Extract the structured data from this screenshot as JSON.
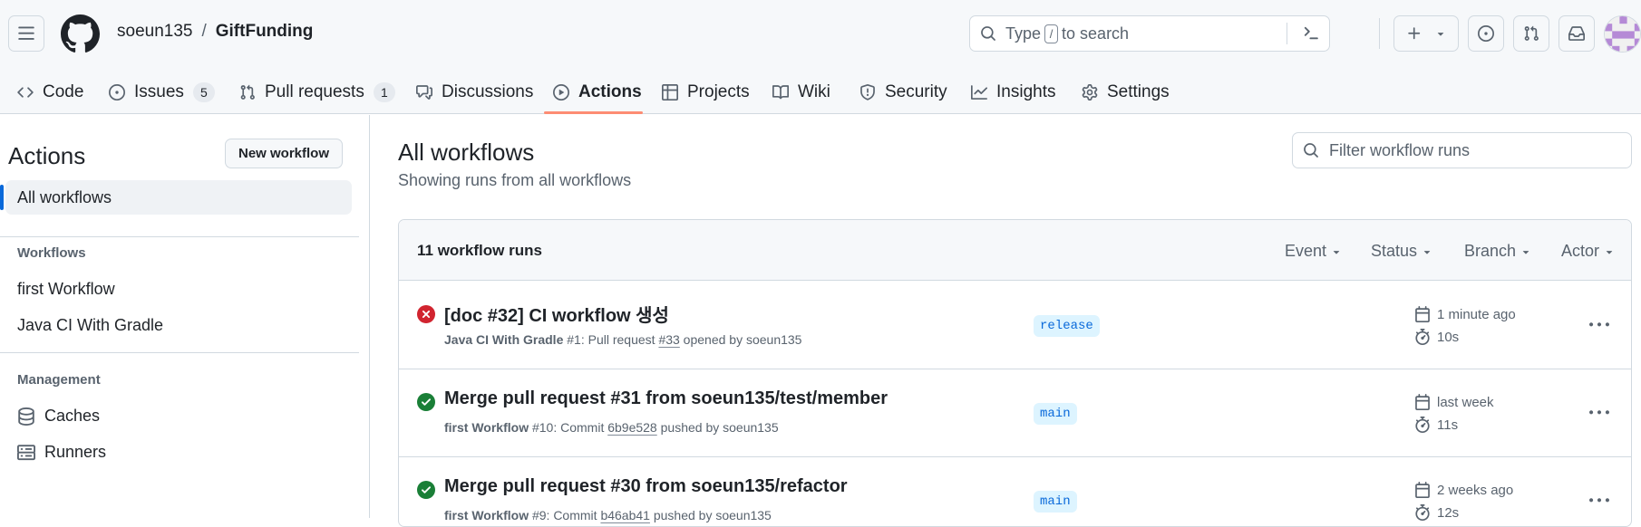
{
  "repo": {
    "owner": "soeun135",
    "separator": "/",
    "name": "GiftFunding"
  },
  "search": {
    "prefix": "Type",
    "key": "/",
    "suffix": "to search"
  },
  "nav": {
    "tabs": [
      {
        "label": "Code",
        "icon": "code-icon"
      },
      {
        "label": "Issues",
        "icon": "issue-opened-icon",
        "count": "5"
      },
      {
        "label": "Pull requests",
        "icon": "git-pull-request-icon",
        "count": "1"
      },
      {
        "label": "Discussions",
        "icon": "comment-discussion-icon"
      },
      {
        "label": "Actions",
        "icon": "play-icon",
        "active": true
      },
      {
        "label": "Projects",
        "icon": "table-icon"
      },
      {
        "label": "Wiki",
        "icon": "book-icon"
      },
      {
        "label": "Security",
        "icon": "shield-icon"
      },
      {
        "label": "Insights",
        "icon": "graph-icon"
      },
      {
        "label": "Settings",
        "icon": "gear-icon"
      }
    ]
  },
  "sidebar": {
    "title": "Actions",
    "new_workflow_label": "New workflow",
    "all_workflows": "All workflows",
    "workflows_heading": "Workflows",
    "workflows": [
      "first Workflow",
      "Java CI With Gradle"
    ],
    "management_heading": "Management",
    "management": [
      {
        "label": "Caches",
        "icon": "database-icon"
      },
      {
        "label": "Runners",
        "icon": "server-icon"
      }
    ]
  },
  "main": {
    "title": "All workflows",
    "subtitle": "Showing runs from all workflows",
    "filter_placeholder": "Filter workflow runs",
    "runs_count": "11 workflow runs",
    "filters": [
      "Event",
      "Status",
      "Branch",
      "Actor"
    ],
    "runs": [
      {
        "status": "failure",
        "title": "[doc #32] CI workflow 생성",
        "workflow": "Java CI With Gradle",
        "number": "#1",
        "event_pre": ": Pull request ",
        "ref": "#33",
        "event_post": " opened by soeun135",
        "branch": "release",
        "time": "1 minute ago",
        "duration": "10s"
      },
      {
        "status": "success",
        "title": "Merge pull request #31 from soeun135/test/member",
        "workflow": "first Workflow",
        "number": "#10",
        "event_pre": ": Commit ",
        "ref": "6b9e528",
        "event_post": " pushed by soeun135",
        "branch": "main",
        "time": "last week",
        "duration": "11s"
      },
      {
        "status": "success",
        "title": "Merge pull request #30 from soeun135/refactor",
        "workflow": "first Workflow",
        "number": "#9",
        "event_pre": ": Commit ",
        "ref": "b46ab41",
        "event_post": " pushed by soeun135",
        "branch": "main",
        "time": "2 weeks ago",
        "duration": "12s"
      }
    ]
  },
  "colors": {
    "accent": "#0969da",
    "failure": "#d1242f",
    "success": "#1a7f37",
    "tab_underline": "#fd8c73",
    "branch_bg": "#ddf4ff"
  }
}
